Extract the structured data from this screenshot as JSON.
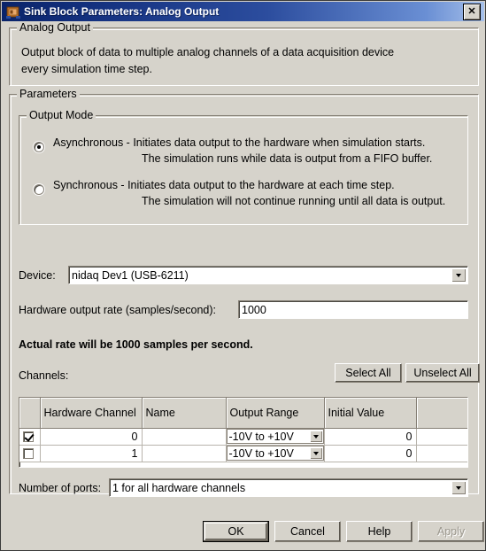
{
  "window": {
    "title": "Sink Block Parameters: Analog Output",
    "icon": "simulink-block-icon",
    "close_label": "✕"
  },
  "description_group": {
    "title": "Analog Output",
    "line1": "Output block of data to multiple analog channels of a data acquisition device",
    "line2": "every simulation time step."
  },
  "parameters_group": {
    "title": "Parameters"
  },
  "output_mode": {
    "title": "Output Mode",
    "options": [
      {
        "id": "asynchronous",
        "line1": "Asynchronous  -  Initiates data output to the hardware when simulation starts.",
        "line2": "The simulation runs while data is output from a FIFO buffer.",
        "selected": true
      },
      {
        "id": "synchronous",
        "line1": "Synchronous  -  Initiates data output to the hardware at each time step.",
        "line2": "The simulation will not continue running until all data is output.",
        "selected": false
      }
    ]
  },
  "device": {
    "label": "Device:",
    "value": "nidaq Dev1 (USB-6211)"
  },
  "rate": {
    "label": "Hardware output rate (samples/second):",
    "value": "1000"
  },
  "actual_rate": {
    "text": "Actual rate will be 1000 samples per second."
  },
  "channels": {
    "label": "Channels:",
    "select_all_label": "Select All",
    "unselect_all_label": "Unselect All",
    "columns": [
      "",
      "Hardware Channel",
      "Name",
      "Output Range",
      "Initial Value",
      ""
    ],
    "rows": [
      {
        "checked": true,
        "hardware_channel": "0",
        "name": "",
        "output_range": "-10V to +10V",
        "initial_value": "0"
      },
      {
        "checked": false,
        "hardware_channel": "1",
        "name": "",
        "output_range": "-10V to +10V",
        "initial_value": "0"
      }
    ]
  },
  "ports": {
    "label": "Number of ports:",
    "value": "1 for all hardware channels"
  },
  "footer": {
    "ok_label": "OK",
    "cancel_label": "Cancel",
    "help_label": "Help",
    "apply_label": "Apply",
    "apply_disabled": true
  },
  "colors": {
    "dialog_background": "#d6d3cb",
    "title_bar_start": "#0a246a",
    "title_bar_end": "#a6c0ea",
    "field_background": "#ffffff",
    "border_shadow": "#868076",
    "disabled_text": "#9a968c"
  }
}
